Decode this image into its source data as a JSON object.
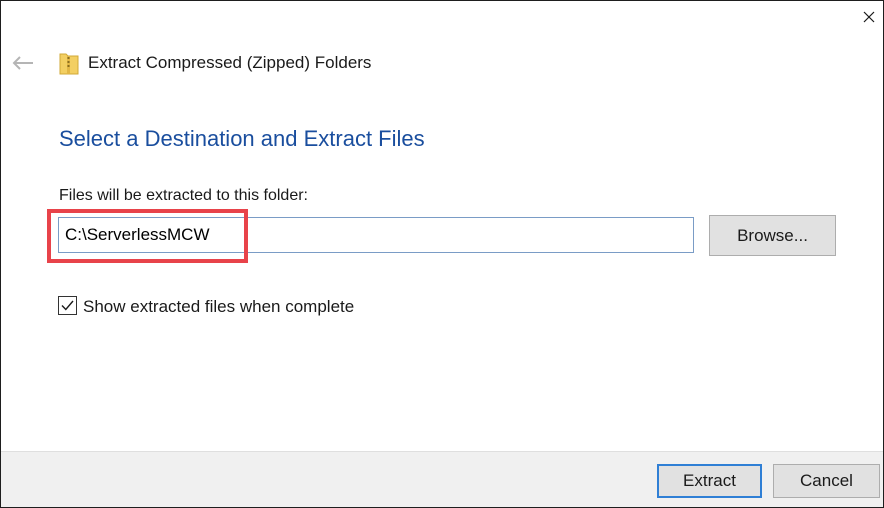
{
  "window": {
    "title": "Extract Compressed (Zipped) Folders"
  },
  "icons": {
    "close": "close-icon",
    "back": "back-arrow-icon",
    "zip_folder": "zip-folder-icon",
    "checkmark": "checkmark-icon"
  },
  "main": {
    "heading": "Select a Destination and Extract Files",
    "destination_label": "Files will be extracted to this folder:",
    "destination_path": "C:\\ServerlessMCW",
    "browse_label": "Browse...",
    "show_files_label": "Show extracted files when complete",
    "show_files_checked": true
  },
  "footer": {
    "extract_label": "Extract",
    "cancel_label": "Cancel"
  },
  "colors": {
    "heading": "#1a4e9e",
    "highlight": "#e8434a",
    "default_button_border": "#2f7fd5",
    "footer_background": "#f0f0f0"
  }
}
